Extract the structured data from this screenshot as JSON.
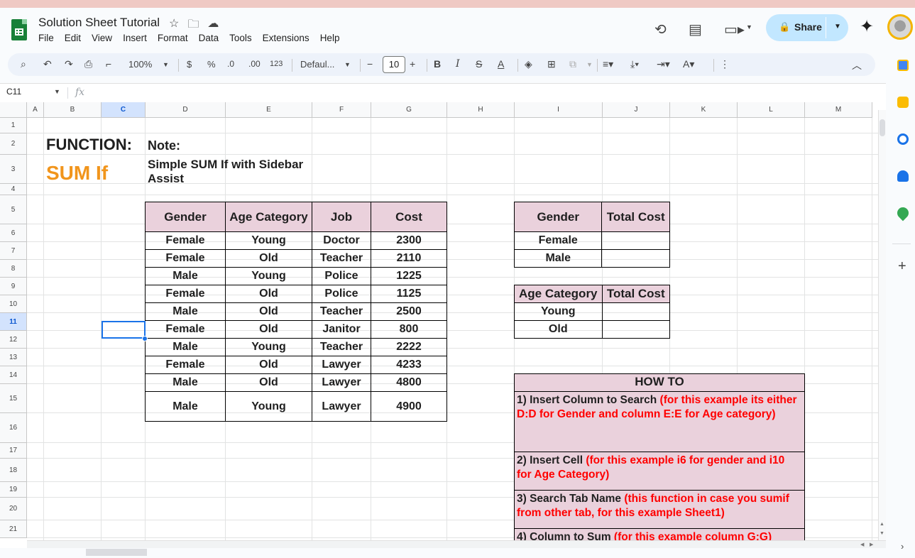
{
  "app": {
    "title": "Solution Sheet Tutorial"
  },
  "menu": [
    "File",
    "Edit",
    "View",
    "Insert",
    "Format",
    "Data",
    "Tools",
    "Extensions",
    "Help"
  ],
  "header": {
    "share_label": "Share"
  },
  "toolbar": {
    "zoom": "100%",
    "currency": "$",
    "percent": "%",
    "dec_less": ".0",
    "dec_more": ".00",
    "number_format": "123",
    "font": "Defaul...",
    "font_size": "10"
  },
  "formula_bar": {
    "name_box": "C11",
    "fx": "fx",
    "content": ""
  },
  "columns": [
    "A",
    "B",
    "C",
    "D",
    "E",
    "F",
    "G",
    "H",
    "I",
    "J",
    "K",
    "L",
    "M"
  ],
  "rows": [
    "1",
    "2",
    "3",
    "4",
    "5",
    "6",
    "7",
    "8",
    "9",
    "10",
    "11",
    "12",
    "13",
    "14",
    "15",
    "16",
    "17",
    "18",
    "19",
    "20",
    "21"
  ],
  "sheet": {
    "function_label": "FUNCTION:",
    "function_name": "SUM If",
    "note_label": "Note:",
    "note_text_line1": "Simple SUM If with Sidebar",
    "note_text_line2": "Assist",
    "data_table": {
      "headers": [
        "Gender",
        "Age Category",
        "Job",
        "Cost"
      ],
      "rows": [
        [
          "Female",
          "Young",
          "Doctor",
          "2300"
        ],
        [
          "Female",
          "Old",
          "Teacher",
          "2110"
        ],
        [
          "Male",
          "Young",
          "Police",
          "1225"
        ],
        [
          "Female",
          "Old",
          "Police",
          "1125"
        ],
        [
          "Male",
          "Old",
          "Teacher",
          "2500"
        ],
        [
          "Female",
          "Old",
          "Janitor",
          "800"
        ],
        [
          "Male",
          "Young",
          "Teacher",
          "2222"
        ],
        [
          "Female",
          "Old",
          "Lawyer",
          "4233"
        ],
        [
          "Male",
          "Old",
          "Lawyer",
          "4800"
        ],
        [
          "Male",
          "Young",
          "Lawyer",
          "4900"
        ]
      ]
    },
    "gender_table": {
      "headers": [
        "Gender",
        "Total Cost"
      ],
      "rows": [
        [
          "Female",
          ""
        ],
        [
          "Male",
          ""
        ]
      ]
    },
    "age_table": {
      "headers": [
        "Age Category",
        "Total Cost"
      ],
      "rows": [
        [
          "Young",
          ""
        ],
        [
          "Old",
          ""
        ]
      ]
    },
    "howto": {
      "title": "HOW TO",
      "steps": [
        {
          "bold": "1) Insert Column to Search ",
          "red": "(for this example its either D:D for Gender and column E:E for Age category)"
        },
        {
          "bold": "2) Insert Cell ",
          "red": "(for this example i6 for gender and i10 for Age Category)"
        },
        {
          "bold": "3) Search Tab Name ",
          "red": "(this function in case you sumif from other tab, for this example Sheet1)"
        },
        {
          "bold": "4) Column to Sum ",
          "red": "(for this example column G:G)"
        }
      ]
    }
  },
  "colors": {
    "header_fill": "#ead1dc",
    "accent_orange": "#f1951c",
    "red_text": "#ff0000",
    "selection": "#1a73e8",
    "share_bg": "#c2e7ff"
  }
}
